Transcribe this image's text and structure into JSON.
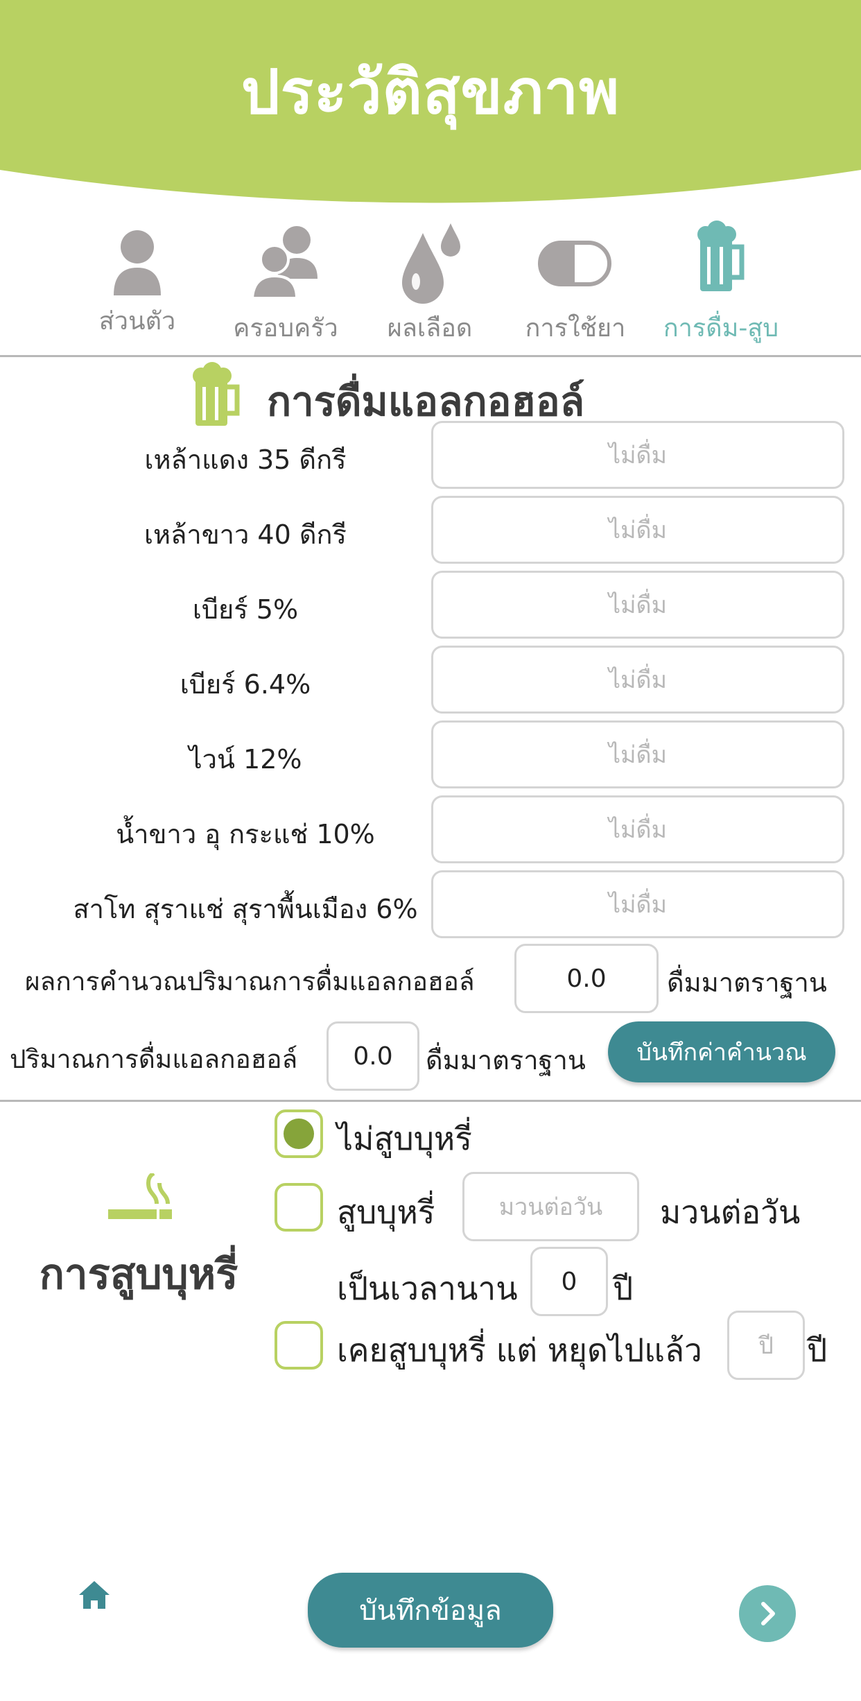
{
  "header": {
    "title": "ประวัติสุขภาพ",
    "color": "#b8d162"
  },
  "tabs": [
    {
      "label": "ส่วนตัว",
      "icon": "person-icon",
      "active": false
    },
    {
      "label": "ครอบครัว",
      "icon": "family-icon",
      "active": false
    },
    {
      "label": "ผลเลือด",
      "icon": "blood-drops-icon",
      "active": false
    },
    {
      "label": "การใช้ยา",
      "icon": "pill-icon",
      "active": false
    },
    {
      "label": "การดื่ม-สูบ",
      "icon": "beer-mug-icon",
      "active": true
    }
  ],
  "alcohol": {
    "title": "การดื่มแอลกอฮอล์",
    "rows": [
      {
        "label": "เหล้าแดง 35 ดีกรี",
        "placeholder": "ไม่ดื่ม"
      },
      {
        "label": "เหล้าขาว 40 ดีกรี",
        "placeholder": "ไม่ดื่ม"
      },
      {
        "label": "เบียร์ 5%",
        "placeholder": "ไม่ดื่ม"
      },
      {
        "label": "เบียร์ 6.4%",
        "placeholder": "ไม่ดื่ม"
      },
      {
        "label": "ไวน์ 12%",
        "placeholder": "ไม่ดื่ม"
      },
      {
        "label": "น้ำขาว อุ กระแช่ 10%",
        "placeholder": "ไม่ดื่ม"
      },
      {
        "label": "สาโท สุราแช่ สุราพื้นเมือง 6%",
        "placeholder": "ไม่ดื่ม"
      }
    ],
    "calc_label": "ผลการคำนวณปริมาณการดื่มแอลกอฮอล์",
    "calc_value": "0.0",
    "calc_unit": "ดื่มมาตราฐาน",
    "amount_label": "ปริมาณการดื่มแอลกอฮอล์",
    "amount_value": "0.0",
    "amount_unit": "ดื่มมาตราฐาน",
    "save_calc_button": "บันทึกค่าคำนวณ"
  },
  "smoking": {
    "title": "การสูบบุหรี่",
    "options": {
      "no_smoke": {
        "label": "ไม่สูบบุหรี่",
        "selected": true
      },
      "smoke": {
        "label": "สูบบุหรี่",
        "selected": false,
        "per_day_placeholder": "มวนต่อวัน",
        "per_day_unit": "มวนต่อวัน",
        "duration_label": "เป็นเวลานาน",
        "duration_value": "0",
        "duration_unit": "ปี"
      },
      "quit": {
        "label": "เคยสูบบุหรี่ แต่ หยุดไปแล้ว",
        "selected": false,
        "years_placeholder": "ปี",
        "years_unit": "ปี"
      }
    }
  },
  "footer": {
    "save_button": "บันทึกข้อมูล",
    "home_icon": "home-icon",
    "next_icon": "chevron-right-icon"
  },
  "colors": {
    "accent": "#b8d162",
    "teal": "#3e8a92",
    "active_tab": "#6fbab4",
    "icon_gray": "#a8a4a4"
  }
}
